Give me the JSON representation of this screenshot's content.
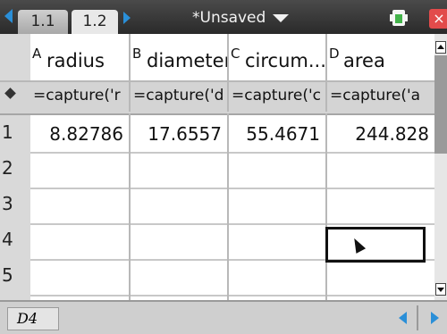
{
  "topbar": {
    "tabs": [
      {
        "label": "1.1"
      },
      {
        "label": "1.2"
      }
    ],
    "title": "*Unsaved",
    "close_label": "×"
  },
  "spreadsheet": {
    "columns": [
      {
        "letter": "A",
        "name": "radius",
        "formula": "=capture('r"
      },
      {
        "letter": "B",
        "name": "diameter",
        "formula": "=capture('d"
      },
      {
        "letter": "C",
        "name": "circum...",
        "formula": "=capture('c"
      },
      {
        "letter": "D",
        "name": "area",
        "formula": "=capture('a"
      }
    ],
    "row_numbers": [
      "1",
      "2",
      "3",
      "4",
      "5"
    ],
    "rows": [
      [
        "8.82786",
        "17.6557",
        "55.4671",
        "244.828"
      ]
    ],
    "selected_cell": "D4"
  },
  "bottombar": {
    "cell_reference": "D4"
  },
  "colors": {
    "accent": "#2a8fd8",
    "close": "#e24b4b",
    "battery": "#43b24a"
  }
}
